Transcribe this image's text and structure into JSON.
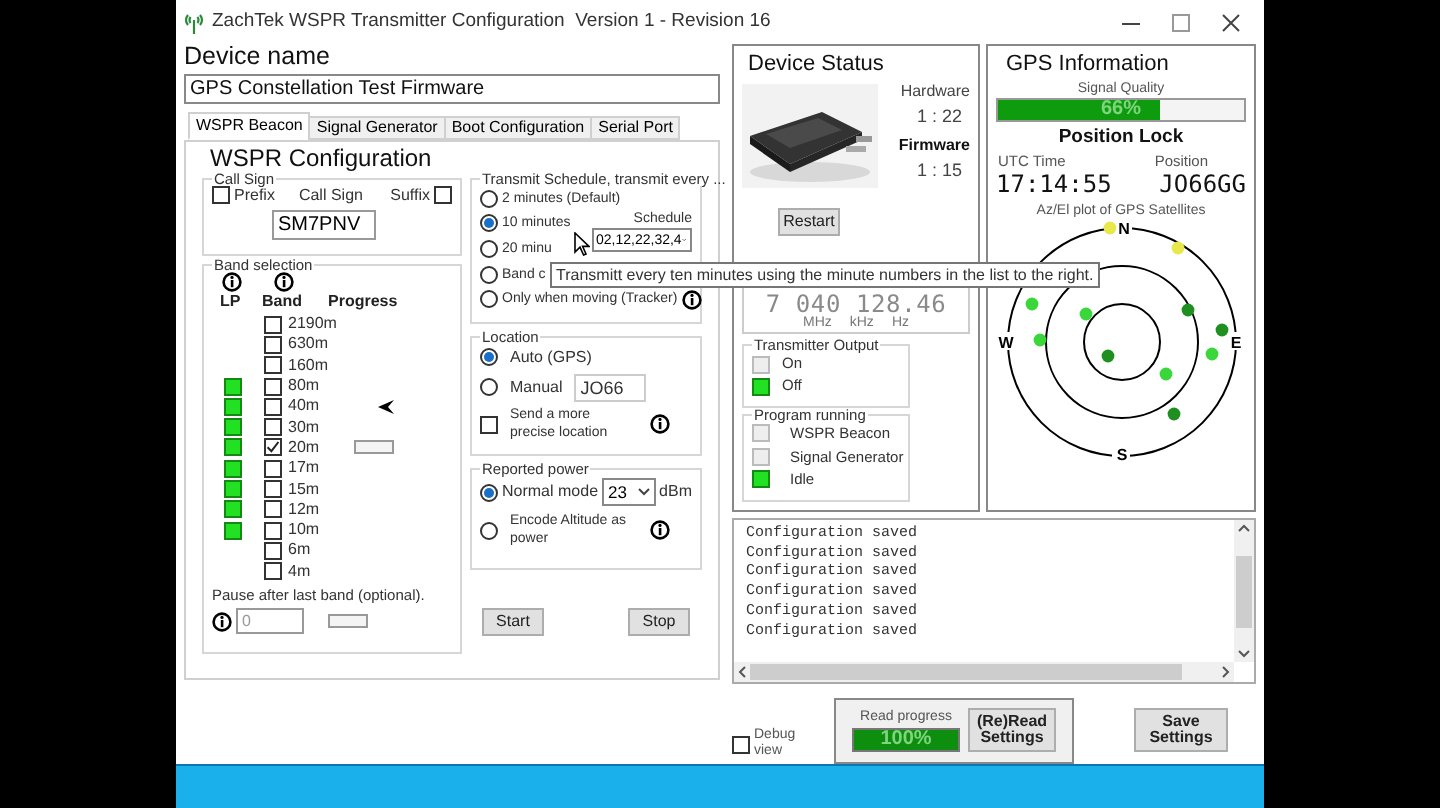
{
  "window": {
    "title": "ZachTek WSPR Transmitter Configuration  Version 1 - Revision 16"
  },
  "device_name": {
    "label": "Device name",
    "value": "GPS Constellation Test Firmware"
  },
  "tabs": [
    {
      "label": "WSPR Beacon",
      "selected": true
    },
    {
      "label": "Signal Generator",
      "selected": false
    },
    {
      "label": "Boot Configuration",
      "selected": false
    },
    {
      "label": "Serial Port",
      "selected": false
    }
  ],
  "wspr": {
    "heading": "WSPR Configuration",
    "call_sign": {
      "title": "Call Sign",
      "prefix": {
        "label": "Prefix",
        "checked": false
      },
      "label": "Call Sign",
      "suffix": {
        "label": "Suffix",
        "checked": false
      },
      "value": "SM7PNV"
    },
    "band_selection": {
      "title": "Band selection",
      "columns": [
        "LP",
        "Band",
        "Progress"
      ],
      "bands": [
        {
          "label": "2190m",
          "lp": false,
          "checked": false,
          "progress_box": false,
          "pointer": false
        },
        {
          "label": "630m",
          "lp": false,
          "checked": false,
          "progress_box": false,
          "pointer": false
        },
        {
          "label": "160m",
          "lp": false,
          "checked": false,
          "progress_box": false,
          "pointer": false
        },
        {
          "label": "80m",
          "lp": true,
          "checked": false,
          "progress_box": false,
          "pointer": false
        },
        {
          "label": "40m",
          "lp": true,
          "checked": false,
          "progress_box": false,
          "pointer": true
        },
        {
          "label": "30m",
          "lp": true,
          "checked": false,
          "progress_box": false,
          "pointer": false
        },
        {
          "label": "20m",
          "lp": true,
          "checked": true,
          "progress_box": true,
          "pointer": false
        },
        {
          "label": "17m",
          "lp": true,
          "checked": false,
          "progress_box": false,
          "pointer": false
        },
        {
          "label": "15m",
          "lp": true,
          "checked": false,
          "progress_box": false,
          "pointer": false
        },
        {
          "label": "12m",
          "lp": true,
          "checked": false,
          "progress_box": false,
          "pointer": false
        },
        {
          "label": "10m",
          "lp": true,
          "checked": false,
          "progress_box": false,
          "pointer": false
        },
        {
          "label": "6m",
          "lp": false,
          "checked": false,
          "progress_box": false,
          "pointer": false
        },
        {
          "label": "4m",
          "lp": false,
          "checked": false,
          "progress_box": false,
          "pointer": false
        }
      ],
      "pause_label": "Pause after last band (optional).",
      "pause_value": "0"
    },
    "schedule": {
      "title": "Transmit Schedule, transmit every ...",
      "schedule_label": "Schedule",
      "schedule_value": "02,12,22,32,4",
      "options": [
        {
          "label": "2 minutes (Default)",
          "selected": false,
          "info": false
        },
        {
          "label": "10 minutes",
          "selected": true,
          "info": false
        },
        {
          "label": "20 minu",
          "selected": false,
          "info": false
        },
        {
          "label": "Band c",
          "selected": false,
          "info": false
        },
        {
          "label": "Only when moving (Tracker)",
          "selected": false,
          "info": true
        }
      ]
    },
    "location": {
      "title": "Location",
      "options": [
        {
          "label": "Auto (GPS)",
          "selected": true
        },
        {
          "label": "Manual",
          "selected": false
        }
      ],
      "locator": "JO66",
      "precise": {
        "label": "Send a more precise location",
        "checked": false
      }
    },
    "power": {
      "title": "Reported power",
      "options": [
        {
          "label": "Normal mode",
          "selected": true
        },
        {
          "label": "Encode Altitude as power",
          "selected": false
        }
      ],
      "value": "23",
      "unit": "dBm"
    },
    "buttons": [
      "Start",
      "Stop"
    ]
  },
  "tooltip": "Transmitt every ten minutes using the minute numbers in the list to the right.",
  "device_status": {
    "title": "Device Status",
    "hardware_label": "Hardware",
    "hardware": "1 : 22",
    "firmware_label": "Firmware",
    "firmware": "1 : 15",
    "restart": "Restart",
    "frequency": "7 040 128.46",
    "units": [
      "MHz",
      "kHz",
      "Hz"
    ],
    "transmitter_output": {
      "title": "Transmitter Output",
      "items": [
        {
          "label": "On",
          "on": false
        },
        {
          "label": "Off",
          "on": true
        }
      ]
    },
    "program_running": {
      "title": "Program running",
      "items": [
        {
          "label": "WSPR Beacon",
          "on": false
        },
        {
          "label": "Signal Generator",
          "on": false
        },
        {
          "label": "Idle",
          "on": true
        }
      ]
    }
  },
  "gps": {
    "title": "GPS Information",
    "signal": {
      "label": "Signal Quality",
      "level": 0.66,
      "reading": "66%"
    },
    "lock": "Position Lock",
    "utc_label": "UTC Time",
    "utc": "17:14:55",
    "position_label": "Position",
    "position": "JO66GG",
    "plot_title": "Az/El plot of GPS Satellites",
    "compass": [
      "N",
      "E",
      "S",
      "W"
    ]
  },
  "log": {
    "lines": [
      "Configuration saved",
      "Configuration saved",
      "Configuration saved",
      "Configuration saved",
      "Configuration saved",
      "Configuration saved"
    ]
  },
  "bottom": {
    "debug": {
      "label": "Debug view",
      "checked": false
    },
    "read_progress": {
      "label": "Read progress",
      "level": 1,
      "reading": "100%"
    },
    "reread": "(Re)Read Settings",
    "save": "Save Settings"
  }
}
